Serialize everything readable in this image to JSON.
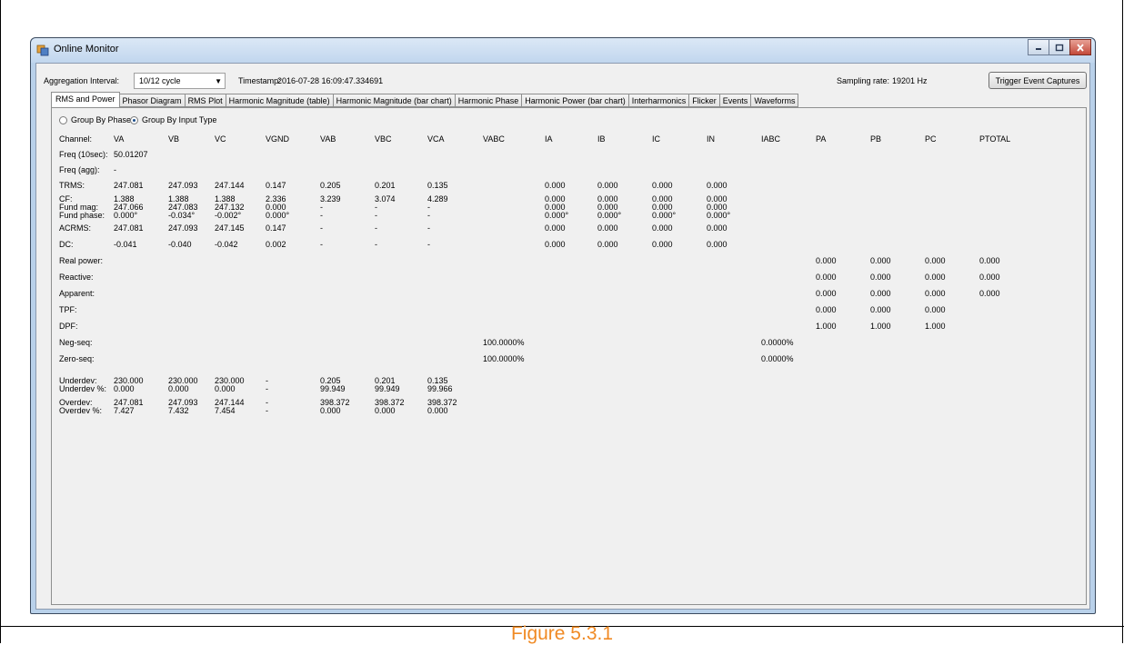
{
  "window": {
    "title": "Online Monitor"
  },
  "toolbar": {
    "aggregation_label": "Aggregation Interval:",
    "aggregation_value": "10/12 cycle",
    "timestamp_label": "Timestamp:",
    "timestamp_value": "2016-07-28 16:09:47.334691",
    "sampling_label": "Sampling rate:",
    "sampling_value": "19201 Hz",
    "trigger_button": "Trigger Event Captures"
  },
  "tabs": [
    "RMS and Power",
    "Phasor Diagram",
    "RMS Plot",
    "Harmonic Magnitude (table)",
    "Harmonic Magnitude (bar chart)",
    "Harmonic Phase",
    "Harmonic Power (bar chart)",
    "Interharmonics",
    "Flicker",
    "Events",
    "Waveforms"
  ],
  "active_tab": "RMS and Power",
  "grouping": {
    "options": [
      "Group By Phase",
      "Group By Input Type"
    ],
    "selected": "Group By Input Type"
  },
  "table": {
    "columns": [
      "VA",
      "VB",
      "VC",
      "VGND",
      "VAB",
      "VBC",
      "VCA",
      "VABC",
      "IA",
      "IB",
      "IC",
      "IN",
      "IABC",
      "PA",
      "PB",
      "PC",
      "PTOTAL"
    ],
    "rows": [
      {
        "label": "Channel:",
        "header": true
      },
      {
        "label": "Freq (10sec):",
        "cells": [
          [
            0,
            "50.01207"
          ]
        ]
      },
      {
        "label": "Freq (agg):",
        "cells": [
          [
            0,
            "-"
          ]
        ]
      },
      {
        "label": "TRMS:",
        "cells": [
          [
            0,
            "247.081"
          ],
          [
            1,
            "247.093"
          ],
          [
            2,
            "247.144"
          ],
          [
            3,
            "0.147"
          ],
          [
            4,
            "0.205"
          ],
          [
            5,
            "0.201"
          ],
          [
            6,
            "0.135"
          ],
          [
            8,
            "0.000"
          ],
          [
            9,
            "0.000"
          ],
          [
            10,
            "0.000"
          ],
          [
            11,
            "0.000"
          ]
        ]
      },
      {
        "label": "CF:",
        "cells": [
          [
            0,
            "1.388"
          ],
          [
            1,
            "1.388"
          ],
          [
            2,
            "1.388"
          ],
          [
            3,
            "2.336"
          ],
          [
            4,
            "3.239"
          ],
          [
            5,
            "3.074"
          ],
          [
            6,
            "4.289"
          ],
          [
            8,
            "0.000"
          ],
          [
            9,
            "0.000"
          ],
          [
            10,
            "0.000"
          ],
          [
            11,
            "0.000"
          ]
        ]
      },
      {
        "label": "Fund mag:",
        "cells": [
          [
            0,
            "247.066"
          ],
          [
            1,
            "247.083"
          ],
          [
            2,
            "247.132"
          ],
          [
            3,
            "0.000"
          ],
          [
            4,
            "-"
          ],
          [
            5,
            "-"
          ],
          [
            6,
            "-"
          ],
          [
            8,
            "0.000"
          ],
          [
            9,
            "0.000"
          ],
          [
            10,
            "0.000"
          ],
          [
            11,
            "0.000"
          ]
        ]
      },
      {
        "label": "Fund phase:",
        "cells": [
          [
            0,
            "0.000°"
          ],
          [
            1,
            "-0.034°"
          ],
          [
            2,
            "-0.002°"
          ],
          [
            3,
            "0.000°"
          ],
          [
            4,
            "-"
          ],
          [
            5,
            "-"
          ],
          [
            6,
            "-"
          ],
          [
            8,
            "0.000°"
          ],
          [
            9,
            "0.000°"
          ],
          [
            10,
            "0.000°"
          ],
          [
            11,
            "0.000°"
          ]
        ]
      },
      {
        "label": "ACRMS:",
        "cells": [
          [
            0,
            "247.081"
          ],
          [
            1,
            "247.093"
          ],
          [
            2,
            "247.145"
          ],
          [
            3,
            "0.147"
          ],
          [
            4,
            "-"
          ],
          [
            5,
            "-"
          ],
          [
            6,
            "-"
          ],
          [
            8,
            "0.000"
          ],
          [
            9,
            "0.000"
          ],
          [
            10,
            "0.000"
          ],
          [
            11,
            "0.000"
          ]
        ]
      },
      {
        "label": "DC:",
        "cells": [
          [
            0,
            "-0.041"
          ],
          [
            1,
            "-0.040"
          ],
          [
            2,
            "-0.042"
          ],
          [
            3,
            "0.002"
          ],
          [
            4,
            "-"
          ],
          [
            5,
            "-"
          ],
          [
            6,
            "-"
          ],
          [
            8,
            "0.000"
          ],
          [
            9,
            "0.000"
          ],
          [
            10,
            "0.000"
          ],
          [
            11,
            "0.000"
          ]
        ]
      },
      {
        "label": "Real power:",
        "cells": [
          [
            13,
            "0.000"
          ],
          [
            14,
            "0.000"
          ],
          [
            15,
            "0.000"
          ],
          [
            16,
            "0.000"
          ]
        ]
      },
      {
        "label": "Reactive:",
        "cells": [
          [
            13,
            "0.000"
          ],
          [
            14,
            "0.000"
          ],
          [
            15,
            "0.000"
          ],
          [
            16,
            "0.000"
          ]
        ]
      },
      {
        "label": "Apparent:",
        "cells": [
          [
            13,
            "0.000"
          ],
          [
            14,
            "0.000"
          ],
          [
            15,
            "0.000"
          ],
          [
            16,
            "0.000"
          ]
        ]
      },
      {
        "label": "TPF:",
        "cells": [
          [
            13,
            "0.000"
          ],
          [
            14,
            "0.000"
          ],
          [
            15,
            "0.000"
          ]
        ]
      },
      {
        "label": "DPF:",
        "cells": [
          [
            13,
            "1.000"
          ],
          [
            14,
            "1.000"
          ],
          [
            15,
            "1.000"
          ]
        ]
      },
      {
        "label": "Neg-seq:",
        "cells": [
          [
            7,
            "100.0000%"
          ],
          [
            12,
            "0.0000%"
          ]
        ]
      },
      {
        "label": "Zero-seq:",
        "cells": [
          [
            7,
            "100.0000%"
          ],
          [
            12,
            "0.0000%"
          ]
        ]
      },
      {
        "label": "Underdev:",
        "cells": [
          [
            0,
            "230.000"
          ],
          [
            1,
            "230.000"
          ],
          [
            2,
            "230.000"
          ],
          [
            3,
            "-"
          ],
          [
            4,
            "0.205"
          ],
          [
            5,
            "0.201"
          ],
          [
            6,
            "0.135"
          ]
        ]
      },
      {
        "label": "Underdev %:",
        "cells": [
          [
            0,
            "0.000"
          ],
          [
            1,
            "0.000"
          ],
          [
            2,
            "0.000"
          ],
          [
            3,
            "-"
          ],
          [
            4,
            "99.949"
          ],
          [
            5,
            "99.949"
          ],
          [
            6,
            "99.966"
          ]
        ]
      },
      {
        "label": "Overdev:",
        "cells": [
          [
            0,
            "247.081"
          ],
          [
            1,
            "247.093"
          ],
          [
            2,
            "247.144"
          ],
          [
            3,
            "-"
          ],
          [
            4,
            "398.372"
          ],
          [
            5,
            "398.372"
          ],
          [
            6,
            "398.372"
          ]
        ]
      },
      {
        "label": "Overdev %:",
        "cells": [
          [
            0,
            "7.427"
          ],
          [
            1,
            "7.432"
          ],
          [
            2,
            "7.454"
          ],
          [
            3,
            "-"
          ],
          [
            4,
            "0.000"
          ],
          [
            5,
            "0.000"
          ],
          [
            6,
            "0.000"
          ]
        ]
      }
    ]
  },
  "caption": "Figure 5.3.1"
}
